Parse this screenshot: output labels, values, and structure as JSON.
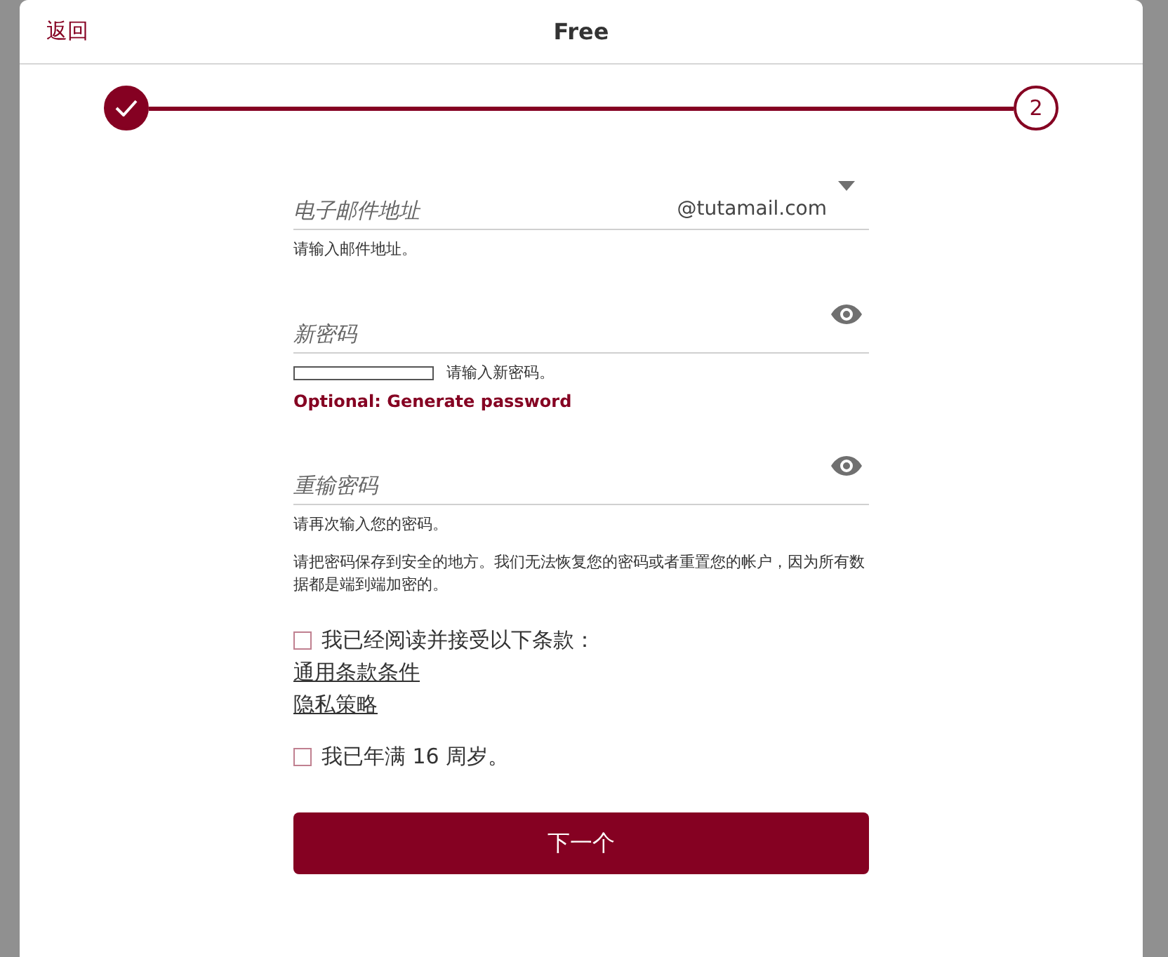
{
  "header": {
    "back": "返回",
    "title": "Free"
  },
  "steps": [
    {
      "done": true
    },
    {
      "done": false,
      "label": "2"
    }
  ],
  "fields": [
    {
      "kind": "email",
      "placeholder": "电子邮件地址",
      "suffix": "@tutamail.com",
      "help": "请输入邮件地址。"
    },
    {
      "kind": "password",
      "placeholder": "新密码",
      "strength": {
        "level": 0,
        "text": "请输入新密码。"
      },
      "link": "Optional: Generate password"
    },
    {
      "kind": "password",
      "placeholder": "重输密码",
      "help": "请再次输入您的密码。"
    }
  ],
  "note": "请把密码保存到安全的地方。我们无法恢复您的密码或者重置您的帐户，因为所有数据都是端到端加密的。",
  "terms": {
    "checked": false,
    "label": "我已经阅读并接受以下条款：",
    "links": [
      "通用条款条件",
      "隐私策略"
    ]
  },
  "age": {
    "checked": false,
    "label": "我已年满 16 周岁。"
  },
  "next_button": "下一个"
}
